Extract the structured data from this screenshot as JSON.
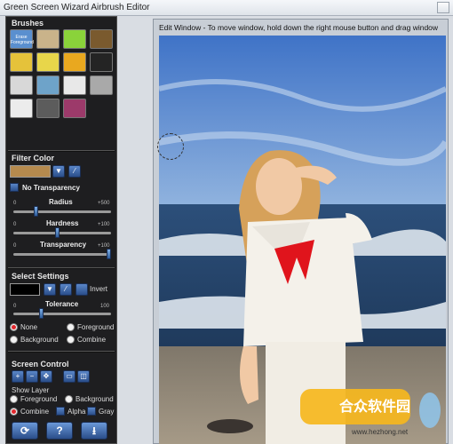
{
  "window": {
    "title": "Green Screen Wizard Airbrush Editor"
  },
  "brushes": {
    "title": "Brushes",
    "items": [
      {
        "name": "brush-erase-foreground",
        "label": "Erase Foreground",
        "bg": "#5a8fcf"
      },
      {
        "name": "brush-flowers",
        "bg": "#c9b38a"
      },
      {
        "name": "brush-green-gradient",
        "bg": "#8ad33a"
      },
      {
        "name": "brush-texture-dots",
        "bg": "#7a5a2e"
      },
      {
        "name": "brush-color-ovals",
        "bg": "#e5c23a"
      },
      {
        "name": "brush-yellow-blue",
        "bg": "#e8d64a"
      },
      {
        "name": "brush-bird",
        "bg": "#e9a81f"
      },
      {
        "name": "brush-tuxedo",
        "bg": "#242424"
      },
      {
        "name": "brush-bride",
        "bg": "#d8d8d8"
      },
      {
        "name": "brush-palm-tree",
        "bg": "#6ea3c9"
      },
      {
        "name": "brush-white-tube",
        "bg": "#e8e8e8"
      },
      {
        "name": "brush-grey-tiles",
        "bg": "#a9a9a9"
      },
      {
        "name": "brush-lightbulb",
        "bg": "#ececec"
      },
      {
        "name": "brush-grey-gradient",
        "bg": "#5c5c5c"
      },
      {
        "name": "brush-palette",
        "bg": "#9c3a6a"
      }
    ]
  },
  "filter_color": {
    "title": "Filter Color",
    "swatch_color": "#b58a4e",
    "no_transparency_label": "No Transparency",
    "radius_label": "Radius",
    "radius_min": "0",
    "radius_max": "+500",
    "radius_value_fraction": 0.22,
    "hardness_label": "Hardness",
    "hardness_min": "0",
    "hardness_max": "+100",
    "hardness_value_fraction": 0.45,
    "transparency_label": "Transparency",
    "transparency_min": "0",
    "transparency_max": "+100",
    "transparency_value_fraction": 1.0
  },
  "select_settings": {
    "title": "Select Settings",
    "swatch_color": "#000000",
    "invert_label": "Invert",
    "tolerance_label": "Tolerance",
    "tolerance_min": "0",
    "tolerance_max": "100",
    "tolerance_value_fraction": 0.28,
    "options": [
      "None",
      "Foreground",
      "Background",
      "Combine"
    ],
    "selected": "None"
  },
  "screen_control": {
    "title": "Screen Control",
    "show_layer_label": "Show Layer",
    "layers": [
      "Foreground",
      "Background",
      "Combine"
    ],
    "selected_layer": "Combine",
    "alpha_label": "Alpha",
    "gray_label": "Gray",
    "help_label": "?"
  },
  "edit_window": {
    "title": "Edit Window - To move window, hold down the right mouse button and drag window"
  },
  "watermark": {
    "text": "合众软件园",
    "url": "www.hezhong.net"
  }
}
